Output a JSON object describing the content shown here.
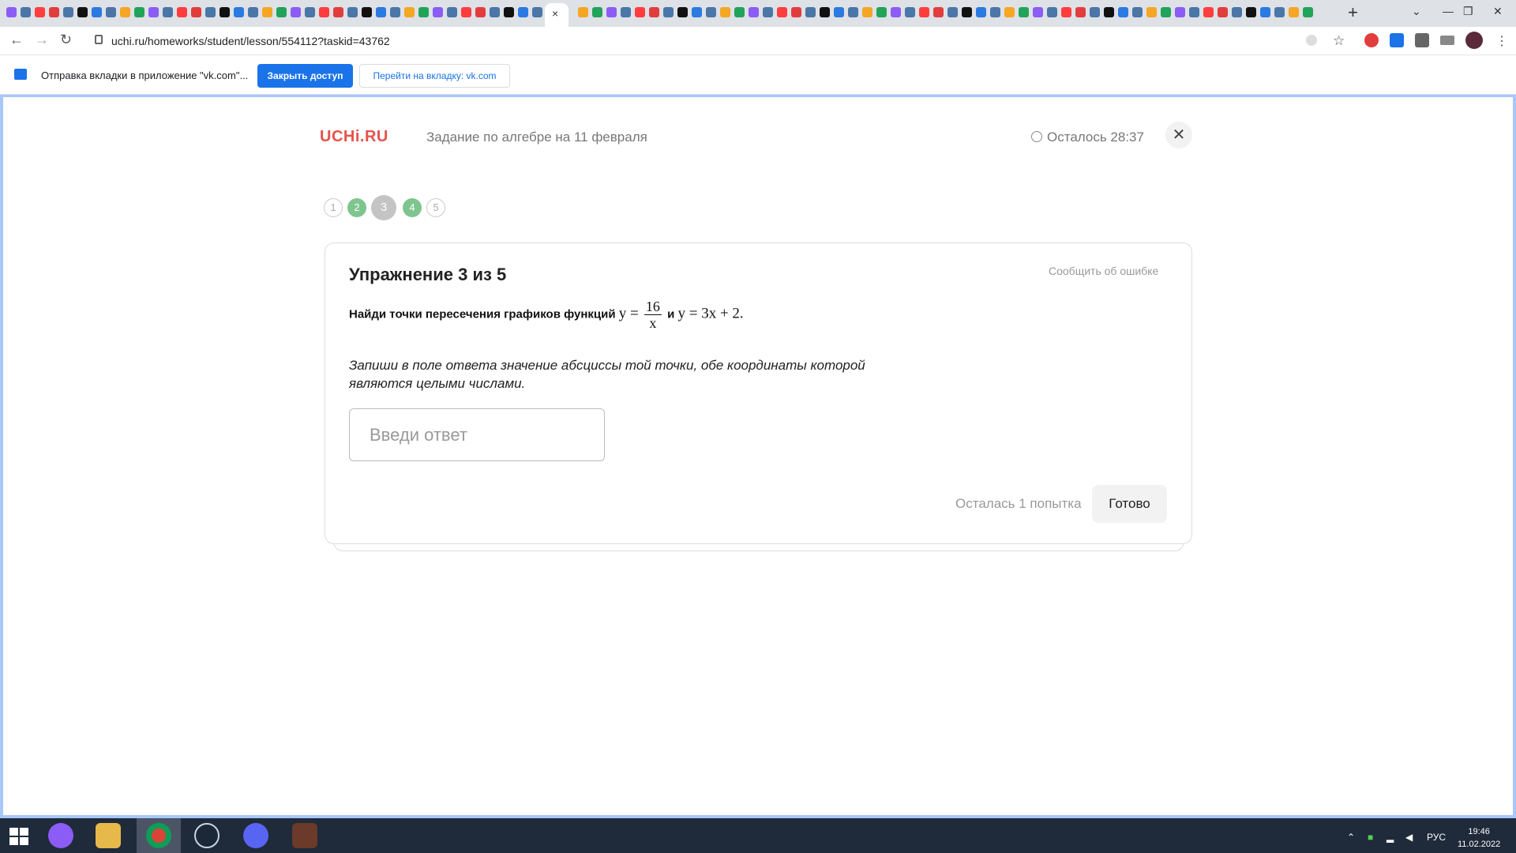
{
  "browser": {
    "url": "uchi.ru/homeworks/student/lesson/554112?taskid=43762",
    "new_tab_symbol": "+",
    "close_tab_symbol": "×"
  },
  "infobar": {
    "message": "Отправка вкладки в приложение \"vk.com\"...",
    "primary_button": "Закрыть доступ",
    "secondary_button": "Перейти на вкладку: vk.com"
  },
  "header": {
    "logo": "UCHi.RU",
    "lesson_title": "Задание по алгебре на 11 февраля",
    "timer": "Осталось 28:37"
  },
  "steps": [
    {
      "label": "1",
      "state": "outline"
    },
    {
      "label": "2",
      "state": "done"
    },
    {
      "label": "3",
      "state": "current"
    },
    {
      "label": "4",
      "state": "done"
    },
    {
      "label": "5",
      "state": "outline"
    }
  ],
  "exercise": {
    "title": "Упражнение 3 из 5",
    "report_link": "Сообщить об ошибке",
    "task_prefix": "Найди точки пересечения графиков функций",
    "func1_lhs": "y =",
    "func1_num": "16",
    "func1_den": "x",
    "conjunction": "и",
    "func2": "y = 3x + 2.",
    "hint": "Запиши в поле ответа значение абсциссы той точки, обе координаты которой являются целыми числами.",
    "answer_placeholder": "Введи ответ",
    "answer_value": "",
    "attempts_left": "Осталась 1 попытка",
    "submit_label": "Готово"
  },
  "taskbar": {
    "language": "РУС",
    "time": "19:46",
    "date": "11.02.2022"
  },
  "colors": {
    "brand": "#e5534b",
    "step_done": "#7ec58e",
    "step_current": "#c4c4c4",
    "chrome_accent": "#1a73e8",
    "taskbar": "#1f2a3a"
  }
}
